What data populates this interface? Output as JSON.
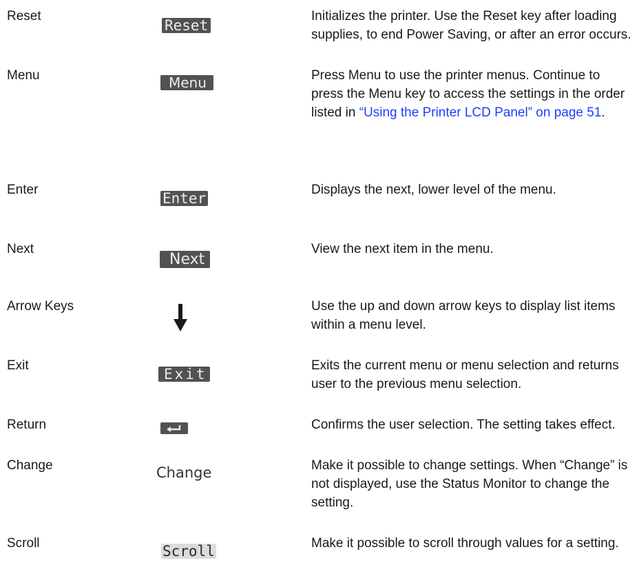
{
  "rows": [
    {
      "name": "Reset",
      "key_label": "Reset",
      "key_icon": "reset-key",
      "description": "Initializes the printer. Use the Reset key after loading supplies, to end Power Saving, or after an error occurs."
    },
    {
      "name": "Menu",
      "key_label": "Menu",
      "key_icon": "menu-key",
      "description_before": "Press Menu to use the printer menus. Continue to press the Menu key to access the settings in the order listed in ",
      "link_text": "“Using the Printer LCD Panel” on page 51",
      "description_after": "."
    },
    {
      "name": "Enter",
      "key_label": "Enter",
      "key_icon": "enter-key",
      "description": "Displays the next, lower level of the menu."
    },
    {
      "name": "Next",
      "key_label": "Next",
      "key_icon": "next-key",
      "description": "View the next item in the menu."
    },
    {
      "name": "Arrow Keys",
      "key_icon": "down-arrow-icon",
      "description": "Use the up and down arrow keys to display list items within a menu level."
    },
    {
      "name": "Exit",
      "key_label": "Exit",
      "key_icon": "exit-key",
      "description": "Exits the current menu or menu selection and returns user to the previous menu selection."
    },
    {
      "name": "Return",
      "key_icon": "return-arrow-icon",
      "description": "Confirms the user selection. The setting takes effect."
    },
    {
      "name": "Change",
      "key_label": "Change",
      "key_icon": "change-key",
      "description": "Make it possible to change settings. When “Change” is not displayed, use the Status Monitor to change the setting."
    },
    {
      "name": "Scroll",
      "key_label": "Scroll",
      "key_icon": "scroll-key",
      "description": "Make it possible to scroll through values for a setting."
    }
  ],
  "colors": {
    "text": "#1a1a1a",
    "link": "#1f3dff",
    "key_bg": "#525252",
    "key_text": "#ececec"
  }
}
